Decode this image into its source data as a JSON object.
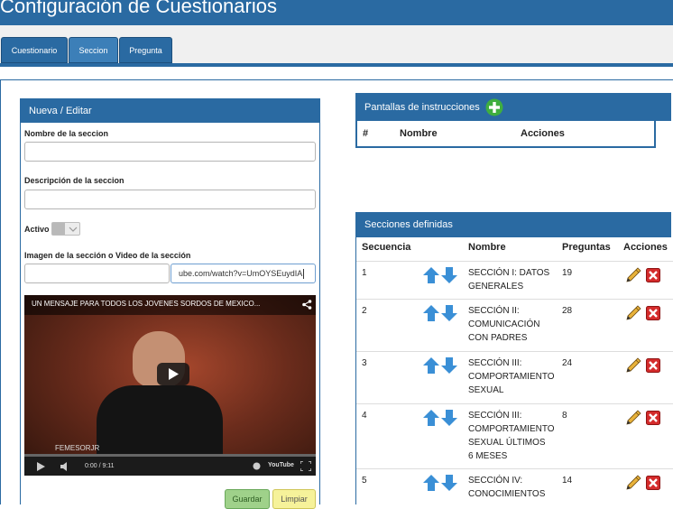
{
  "page_title": "Configuración de Cuestionarios",
  "tabs": [
    {
      "label": "Cuestionario"
    },
    {
      "label": "Seccion"
    },
    {
      "label": "Pregunta"
    }
  ],
  "form_panel": {
    "title": "Nueva / Editar",
    "nombre_label": "Nombre de la seccion",
    "nombre_value": "",
    "descripcion_label": "Descripción de la seccion",
    "descripcion_value": "",
    "activo_label": "Activo",
    "imagen_label": "Imagen de la sección o Video de la sección",
    "imagen_value": "",
    "video_url_value": "ube.com/watch?v=UmOYSEuydIA",
    "guardar_label": "Guardar",
    "limpiar_label": "Limpiar"
  },
  "video": {
    "title": "UN MENSAJE PARA TODOS LOS JOVENES SORDOS DE MEXICO...",
    "watermark": "FEMESORJR",
    "time": "0:00 / 9:11",
    "brand": "YouTube"
  },
  "instrucciones_panel": {
    "title": "Pantallas de instrucciones",
    "columns": [
      "#",
      "Nombre",
      "Acciones"
    ]
  },
  "secciones_panel": {
    "title": "Secciones definidas",
    "columns": [
      "Secuencia",
      "Nombre",
      "Preguntas",
      "Acciones"
    ],
    "rows": [
      {
        "secuencia": "1",
        "nombre": [
          "SECCIÓN I: DATOS",
          "GENERALES"
        ],
        "preguntas": "19"
      },
      {
        "secuencia": "2",
        "nombre": [
          "SECCIÓN II:",
          "COMUNICACIÓN",
          "CON PADRES"
        ],
        "preguntas": "28"
      },
      {
        "secuencia": "3",
        "nombre": [
          "SECCIÓN III:",
          "COMPORTAMIENTO",
          "SEXUAL"
        ],
        "preguntas": "24"
      },
      {
        "secuencia": "4",
        "nombre": [
          "SECCIÓN III:",
          "COMPORTAMIENTO",
          "SEXUAL ÚLTIMOS",
          "6 MESES"
        ],
        "preguntas": "8"
      },
      {
        "secuencia": "5",
        "nombre": [
          "SECCIÓN IV:",
          "CONOCIMIENTOS"
        ],
        "preguntas": "14"
      }
    ]
  },
  "colors": {
    "primary": "#2a6aa2",
    "add_green": "#3fae3f",
    "arrow_blue": "#3a8fd6",
    "delete_red": "#d42b2b",
    "guardar_bg": "#9fd18a",
    "limpiar_bg": "#f6f29a"
  },
  "icons": {
    "add": "plus-circle-icon",
    "move": "up-down-arrows-icon",
    "edit": "pencil-icon",
    "delete": "delete-x-icon",
    "play": "play-icon",
    "share": "share-icon"
  }
}
